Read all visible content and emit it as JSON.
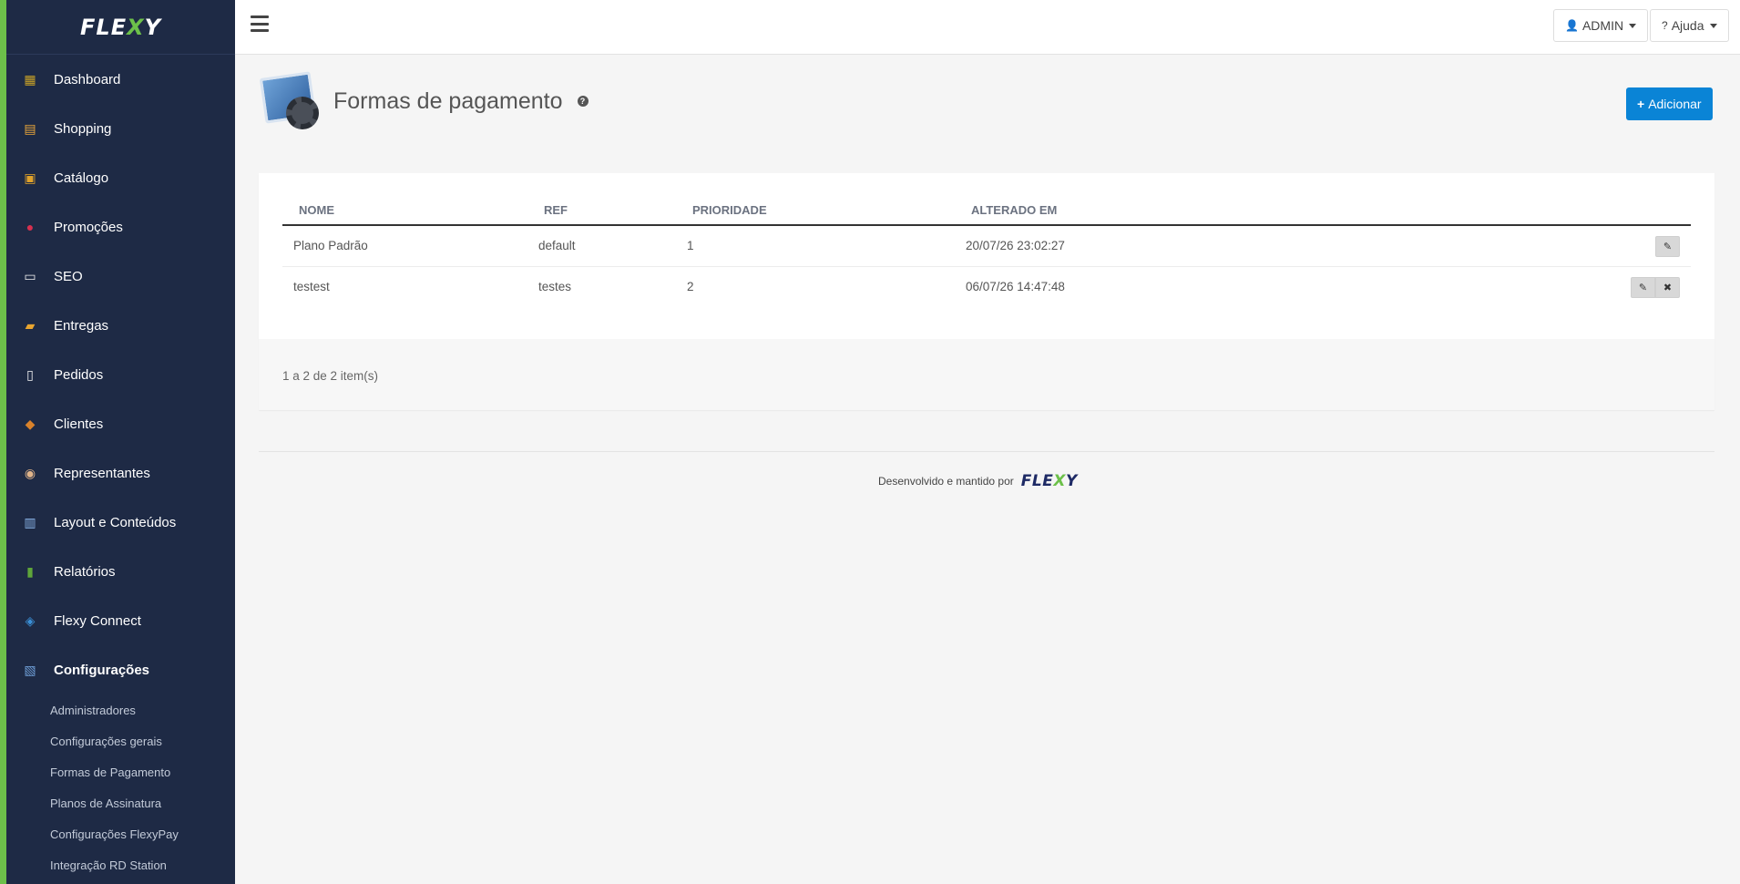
{
  "brand": {
    "logo_left": "FLE",
    "logo_x": "X",
    "logo_right": "Y"
  },
  "sidebar": {
    "items": [
      {
        "label": "Dashboard",
        "icon": "dashboard-icon",
        "color": "#c9a227"
      },
      {
        "label": "Shopping",
        "icon": "shopping-icon",
        "color": "#e8a63a"
      },
      {
        "label": "Catálogo",
        "icon": "catalog-icon",
        "color": "#e0a22b"
      },
      {
        "label": "Promoções",
        "icon": "promotions-icon",
        "color": "#d6304f"
      },
      {
        "label": "SEO",
        "icon": "seo-icon",
        "color": "#f0f0f0"
      },
      {
        "label": "Entregas",
        "icon": "delivery-icon",
        "color": "#e9a530"
      },
      {
        "label": "Pedidos",
        "icon": "orders-icon",
        "color": "#f4f4f4"
      },
      {
        "label": "Clientes",
        "icon": "customers-icon",
        "color": "#d9822b"
      },
      {
        "label": "Representantes",
        "icon": "representatives-icon",
        "color": "#e0b48a"
      },
      {
        "label": "Layout e Conteúdos",
        "icon": "layout-icon",
        "color": "#8ab4e8"
      },
      {
        "label": "Relatórios",
        "icon": "reports-icon",
        "color": "#5fa63a"
      },
      {
        "label": "Flexy Connect",
        "icon": "connect-icon",
        "color": "#3a8fd6"
      },
      {
        "label": "Configurações",
        "icon": "settings-icon",
        "color": "#6f9fd8",
        "active": true
      }
    ],
    "subitems": [
      "Administradores",
      "Configurações gerais",
      "Formas de Pagamento",
      "Planos de Assinatura",
      "Configurações FlexyPay",
      "Integração RD Station"
    ]
  },
  "topbar": {
    "admin_label": "ADMIN",
    "help_label": "Ajuda"
  },
  "page": {
    "title": "Formas de pagamento",
    "add_label": "Adicionar"
  },
  "table": {
    "headers": [
      "NOME",
      "REF",
      "PRIORIDADE",
      "ALTERADO EM"
    ],
    "rows": [
      {
        "nome": "Plano Padrão",
        "ref": "default",
        "prioridade": "1",
        "alterado": "20/07/26 23:02:27",
        "deletable": false
      },
      {
        "nome": "testest",
        "ref": "testes",
        "prioridade": "2",
        "alterado": "06/07/26 14:47:48",
        "deletable": true
      }
    ],
    "count_text": "1 a 2 de 2 item(s)"
  },
  "footer": {
    "text": "Desenvolvido e mantido por",
    "logo_left": "FLE",
    "logo_x": "X",
    "logo_right": "Y"
  }
}
